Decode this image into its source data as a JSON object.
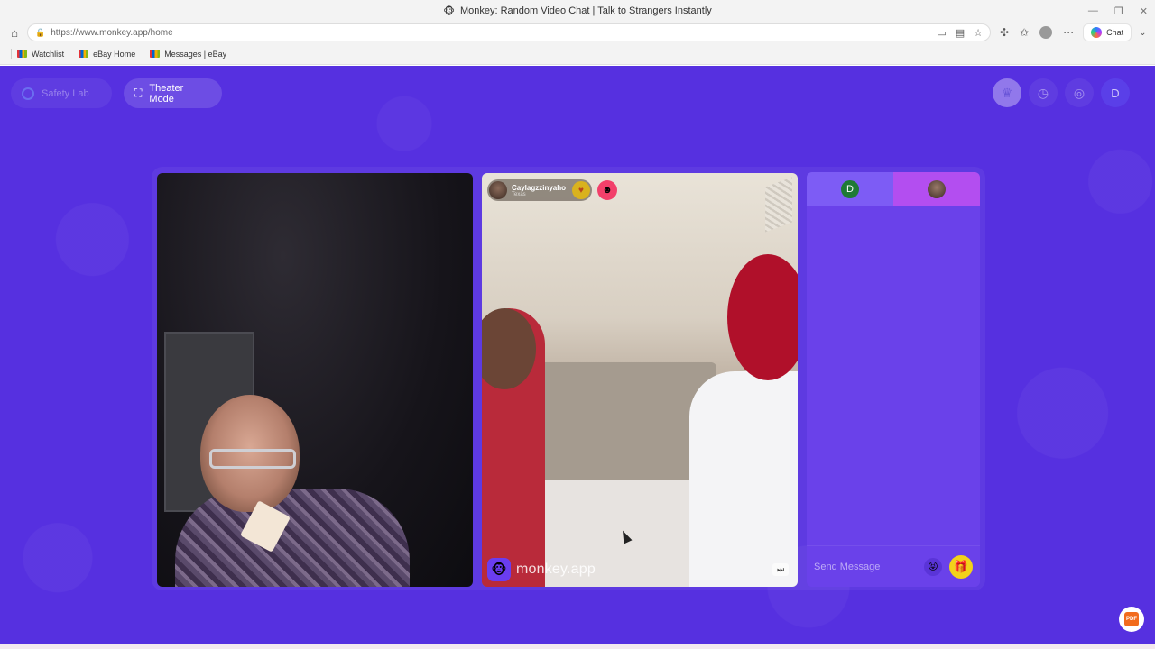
{
  "browser": {
    "title": "Monkey: Random Video Chat | Talk to Strangers Instantly",
    "favicon": "🐵",
    "url": "https://www.monkey.app/home",
    "copilot_label": "Chat",
    "bookmarks": [
      {
        "label": "Watchlist"
      },
      {
        "label": "eBay Home"
      },
      {
        "label": "Messages | eBay"
      }
    ]
  },
  "header": {
    "safety_lab_label": "Safety Lab",
    "theater_mode_label": "Theater Mode",
    "account_initial": "D"
  },
  "stranger": {
    "name": "Caylagzzinyaho",
    "location": "Texas"
  },
  "watermark": {
    "text": "monkey.app"
  },
  "chat": {
    "self_initial": "D",
    "placeholder": "Send Message"
  },
  "pdf_label": "PDF",
  "colors": {
    "page_bg": "#5630e0",
    "chat_bg": "#6a41ea",
    "gift": "#f2d21a",
    "tab_active": "#b34ef0"
  }
}
